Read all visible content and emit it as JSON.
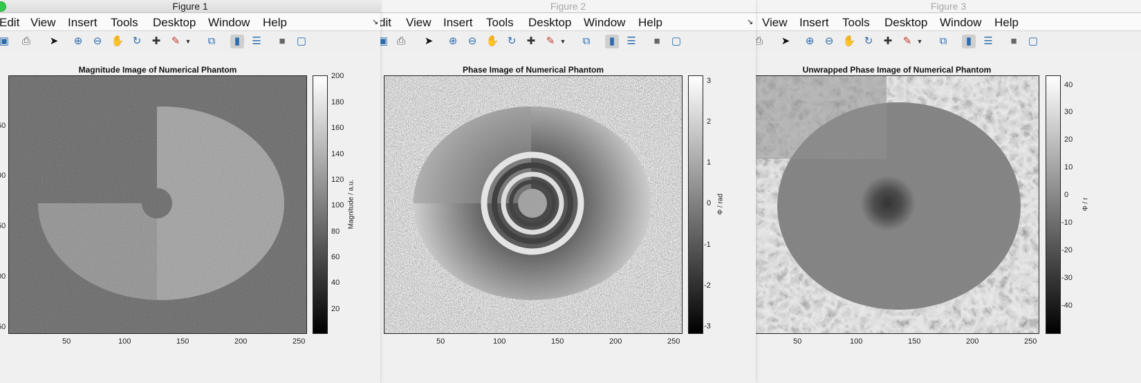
{
  "menu_labels": [
    "Edit",
    "View",
    "Insert",
    "Tools",
    "Desktop",
    "Window",
    "Help"
  ],
  "menu_labels_fig2": [
    "dit",
    "View",
    "Insert",
    "Tools",
    "Desktop",
    "Window",
    "Help"
  ],
  "menu_labels_fig3": [
    "View",
    "Insert",
    "Tools",
    "Desktop",
    "Window",
    "Help"
  ],
  "toolbar_icons": [
    "save-icon",
    "print-icon",
    "pointer-icon",
    "zoom-in-icon",
    "zoom-out-icon",
    "pan-icon",
    "rotate-3d-icon",
    "data-cursor-icon",
    "brush-icon",
    "brush-dropdown-icon",
    "link-plot-icon",
    "colorbar-icon",
    "legend-icon",
    "hide-plot-tools-icon",
    "show-plot-tools-icon"
  ],
  "fig1": {
    "window_title": "Figure 1",
    "plot_title": "Magnitude Image of Numerical Phantom",
    "colorbar_label": "Magnitude / a.u.",
    "colorbar_ticks": [
      "200",
      "180",
      "160",
      "140",
      "120",
      "100",
      "80",
      "60",
      "40",
      "20"
    ],
    "x_ticks": [
      "50",
      "100",
      "150",
      "200",
      "250"
    ],
    "y_ticks_partial": [
      "50",
      "00",
      "50",
      "00",
      "50"
    ]
  },
  "fig2": {
    "window_title": "Figure 2",
    "plot_title": "Phase Image of Numerical Phantom",
    "colorbar_label": "Φ / rad",
    "colorbar_ticks": [
      "3",
      "2",
      "1",
      "0",
      "-1",
      "-2",
      "-3"
    ],
    "x_ticks": [
      "50",
      "100",
      "150",
      "200",
      "250"
    ]
  },
  "fig3": {
    "window_title": "Figure 3",
    "plot_title": "Unwrapped Phase Image of Numerical Phantom",
    "colorbar_label": "Φ / r",
    "colorbar_ticks": [
      "40",
      "30",
      "20",
      "10",
      "0",
      "-10",
      "-20",
      "-30",
      "-40"
    ],
    "x_ticks": [
      "50",
      "100",
      "150",
      "200",
      "250"
    ]
  },
  "colors": {
    "accent": "#2b6cb0",
    "window_bg": "#f0f0f0",
    "traffic_green": "#34c84a"
  }
}
